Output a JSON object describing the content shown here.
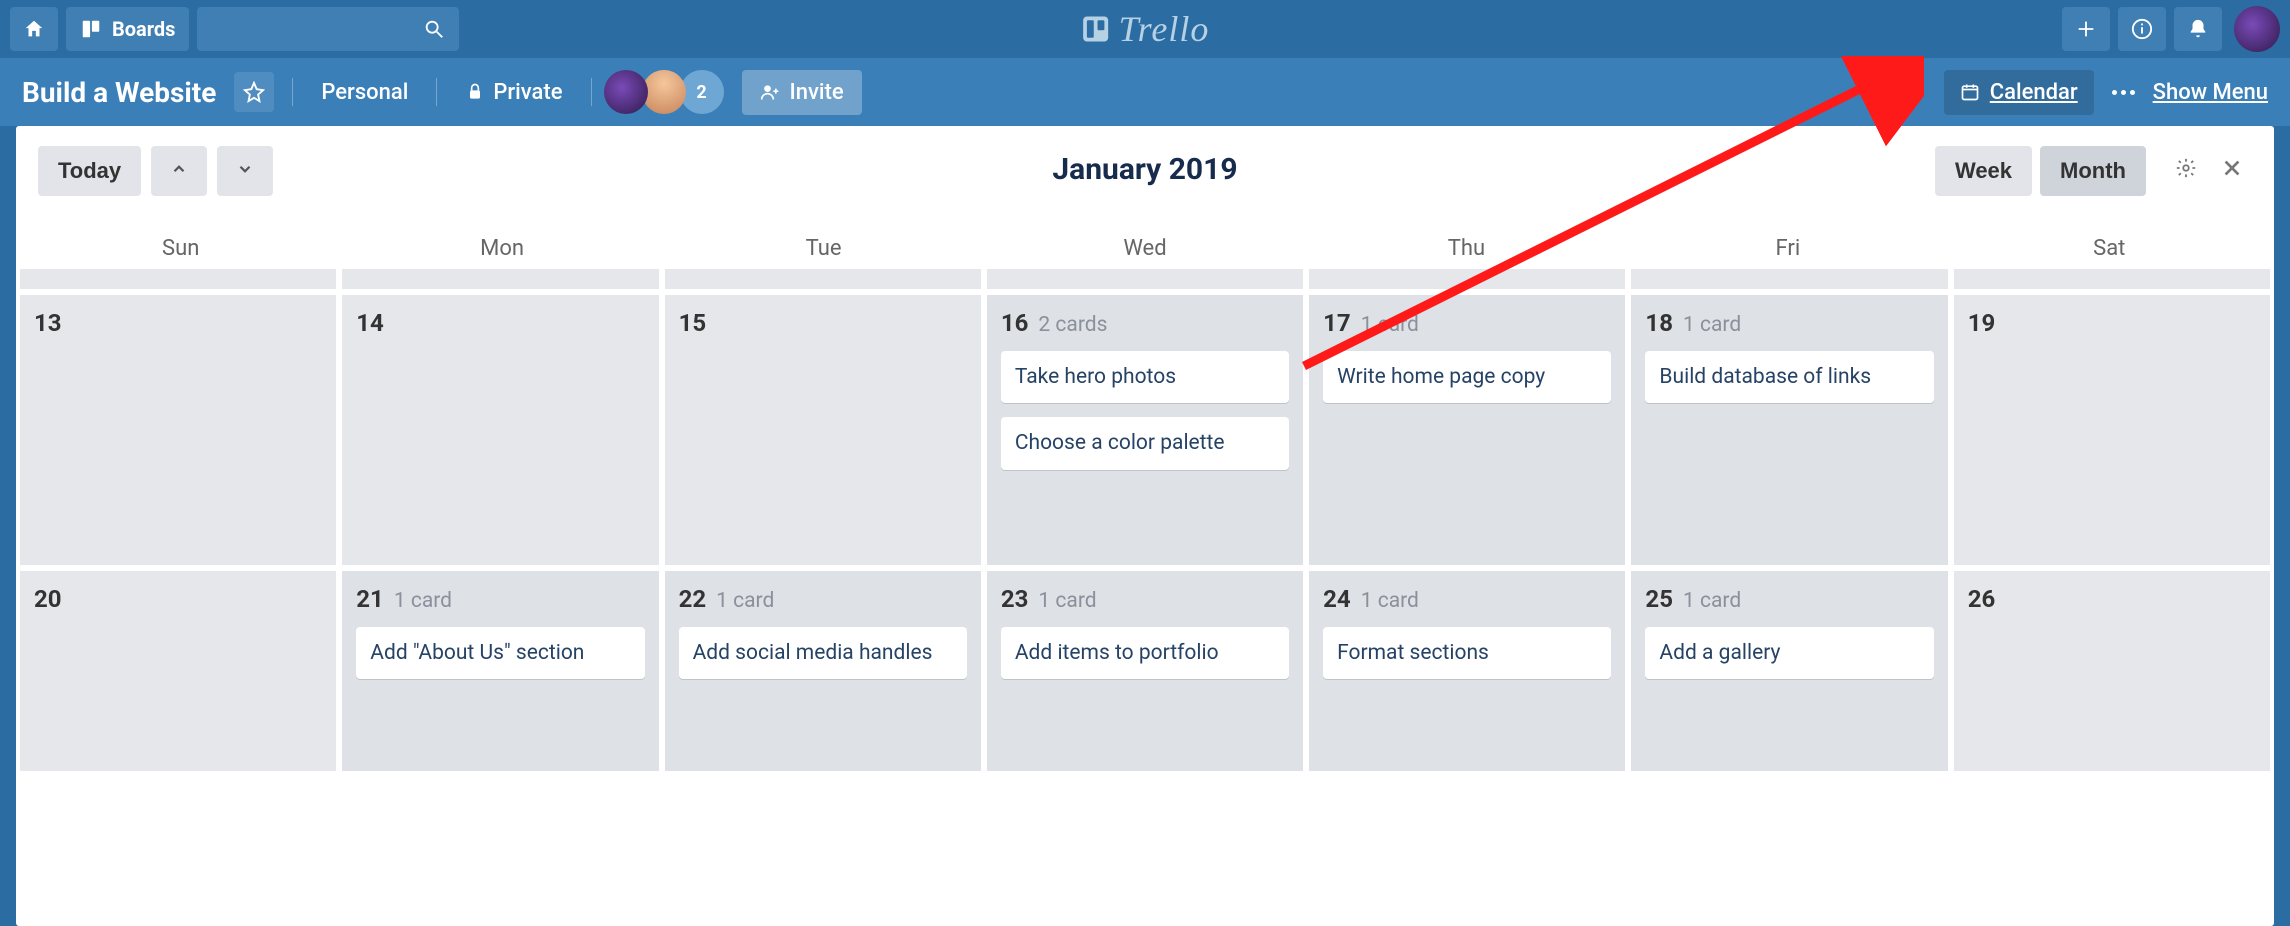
{
  "topnav": {
    "boards_label": "Boards",
    "logo_text": "Trello"
  },
  "boardbar": {
    "title": "Build a Website",
    "team": "Personal",
    "visibility": "Private",
    "member_badge": "2",
    "invite_label": "Invite",
    "calendar_label": "Calendar",
    "showmenu_label": "Show Menu"
  },
  "cal": {
    "today_label": "Today",
    "month_label": "January 2019",
    "week_label": "Week",
    "month_btn_label": "Month",
    "days": [
      "Sun",
      "Mon",
      "Tue",
      "Wed",
      "Thu",
      "Fri",
      "Sat"
    ]
  },
  "weeks": [
    [
      {
        "day": "13"
      },
      {
        "day": "14"
      },
      {
        "day": "15"
      },
      {
        "day": "16",
        "count": "2 cards",
        "cards": [
          "Take hero photos",
          "Choose a color palette"
        ]
      },
      {
        "day": "17",
        "count": "1 card",
        "cards": [
          "Write home page copy"
        ]
      },
      {
        "day": "18",
        "count": "1 card",
        "cards": [
          "Build database of links"
        ]
      },
      {
        "day": "19"
      }
    ],
    [
      {
        "day": "20"
      },
      {
        "day": "21",
        "count": "1 card",
        "cards": [
          "Add \"About Us\" section"
        ]
      },
      {
        "day": "22",
        "count": "1 card",
        "cards": [
          "Add social media handles"
        ]
      },
      {
        "day": "23",
        "count": "1 card",
        "cards": [
          "Add items to portfolio"
        ]
      },
      {
        "day": "24",
        "count": "1 card",
        "cards": [
          "Format sections"
        ]
      },
      {
        "day": "25",
        "count": "1 card",
        "cards": [
          "Add a gallery"
        ]
      },
      {
        "day": "26"
      }
    ]
  ]
}
